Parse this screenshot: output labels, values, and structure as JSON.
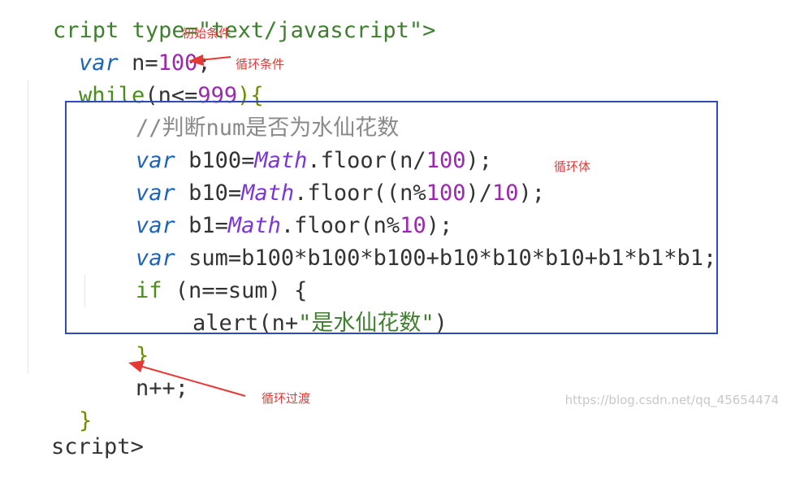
{
  "code": {
    "l0": "cript type=\"text/javascript\">",
    "l1": {
      "kw": "var",
      "id": " n=",
      "num": "100",
      "end": ";"
    },
    "l2": {
      "kw": "while",
      "open": "(",
      "id": "n<=",
      "num": "999",
      "close": "){"
    },
    "l3": "//判断num是否为水仙花数",
    "l4": {
      "kw": "var",
      "pre": " b100=",
      "obj": "Math",
      "mid": ".floor(n/",
      "num": "100",
      "end": ");"
    },
    "l5": {
      "kw": "var",
      "pre": " b10=",
      "obj": "Math",
      "mid": ".floor((n%",
      "num": "100",
      "mid2": ")/",
      "num2": "10",
      "end": ");"
    },
    "l6": {
      "kw": "var",
      "pre": " b1=",
      "obj": "Math",
      "mid": ".floor(n%",
      "num": "10",
      "end": ");"
    },
    "l7": {
      "kw": "var",
      "rest": " sum=b100*b100*b100+b10*b10*b10+b1*b1*b1;"
    },
    "l8": {
      "kw": "if",
      "rest": " (n==sum) {"
    },
    "l9": {
      "fn": "alert",
      "open": "(n+",
      "str": "\"是水仙花数\"",
      "close": ")"
    },
    "l10": "}",
    "l11": "n++;",
    "l12": "}",
    "l13": "script>"
  },
  "annotations": {
    "init": "初始条件",
    "cond": "循环条件",
    "body": "循环体",
    "step": "循环过渡"
  },
  "watermark": "https://blog.csdn.net/qq_45654474",
  "colors": {
    "annotation": "#e53935",
    "box": "#2d4bbf"
  }
}
